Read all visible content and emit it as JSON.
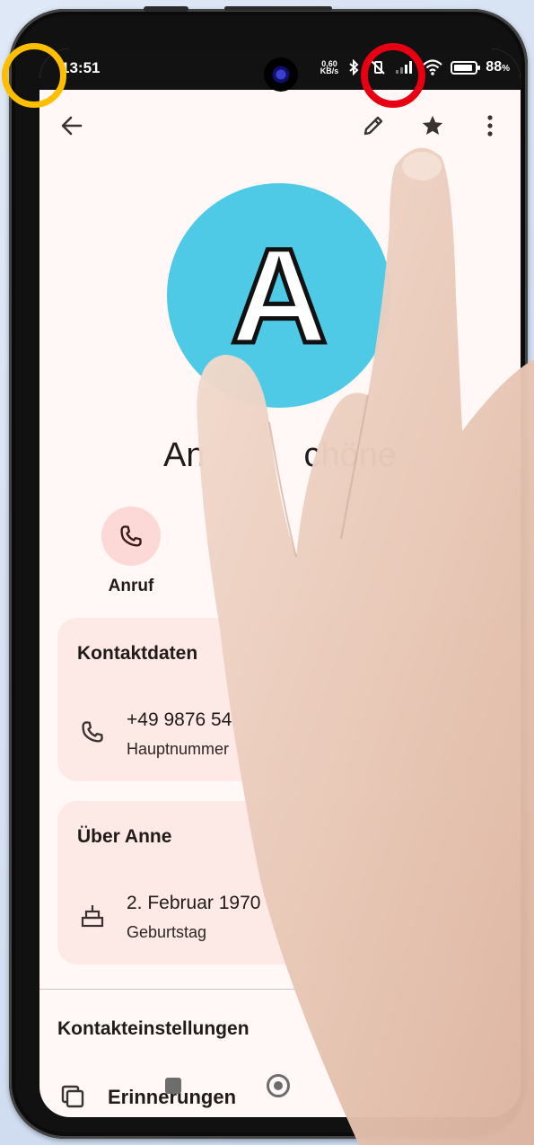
{
  "status_bar": {
    "time": "13:51",
    "speed_value": "0,60",
    "speed_unit": "KB/s",
    "battery_value": "88",
    "battery_unit": "%"
  },
  "toolbar": {
    "back_icon": "arrow-left-icon",
    "edit_icon": "pencil-icon",
    "favorite_icon": "star-icon",
    "more_icon": "more-vert-icon"
  },
  "contact": {
    "avatar_letter": "A",
    "avatar_color": "#4ecae6",
    "name_left": "An",
    "name_right": "chöne"
  },
  "actions": {
    "call_label": "Anruf"
  },
  "contact_details": {
    "title": "Kontaktdaten",
    "phone_number": "+49 9876 54",
    "phone_type": "Hauptnummer"
  },
  "about": {
    "title": "Über Anne",
    "birthday_date": "2. Februar 1970",
    "birthday_label": "Geburtstag"
  },
  "settings": {
    "title": "Kontakteinstellungen",
    "reminders_label": "Erinnerungen"
  },
  "colors": {
    "highlight_back": "#ffbf00",
    "highlight_favorite": "#e60012",
    "card_background": "#fde9e6"
  }
}
